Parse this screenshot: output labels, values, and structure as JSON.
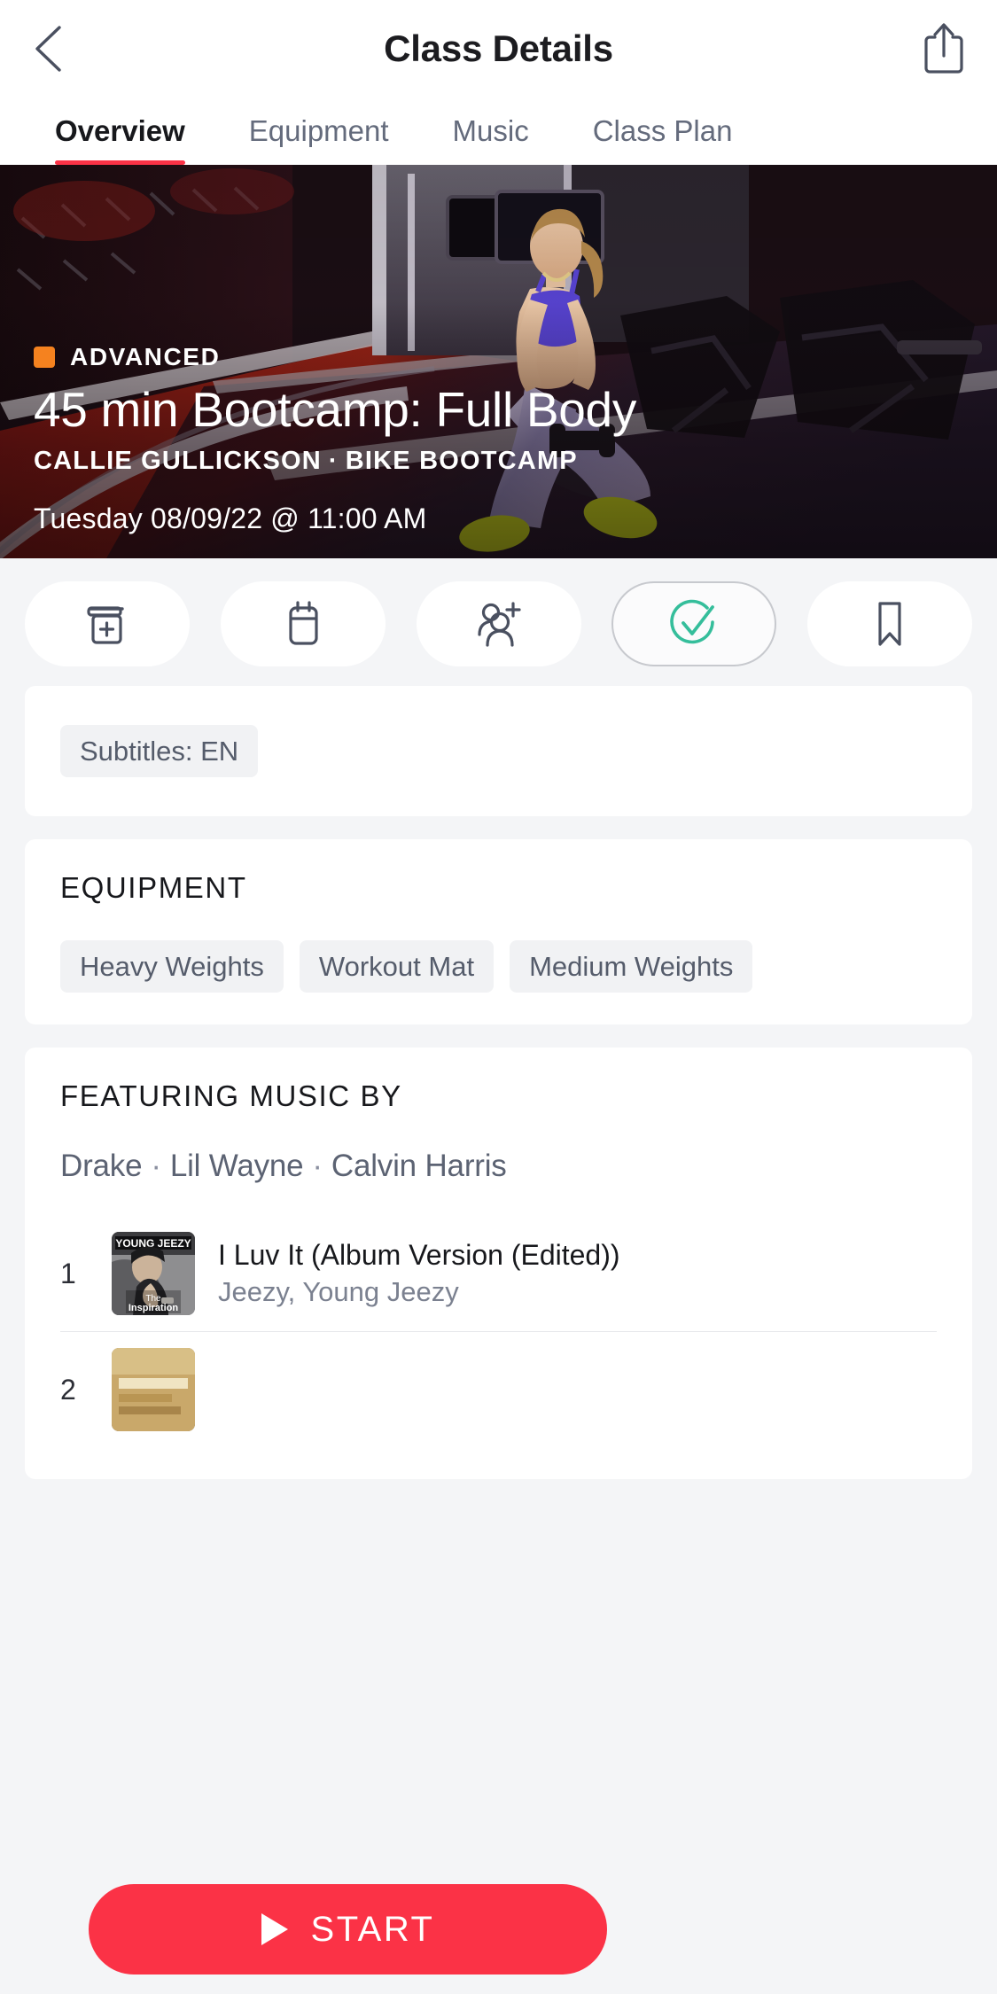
{
  "header": {
    "title": "Class Details",
    "back_icon": "chevron-left-icon",
    "share_icon": "share-icon"
  },
  "tabs": [
    {
      "label": "Overview",
      "active": true
    },
    {
      "label": "Equipment",
      "active": false
    },
    {
      "label": "Music",
      "active": false
    },
    {
      "label": "Class Plan",
      "active": false
    }
  ],
  "hero": {
    "difficulty": "ADVANCED",
    "difficulty_color": "#F5821F",
    "title": "45 min Bootcamp: Full Body",
    "instructor": "CALLIE GULLICKSON",
    "separator": "·",
    "discipline": "BIKE BOOTCAMP",
    "datetime": "Tuesday 08/09/22 @ 11:00 AM"
  },
  "actions": [
    {
      "name": "add-to-stack-button",
      "icon": "stack-add-icon",
      "active": false
    },
    {
      "name": "schedule-button",
      "icon": "calendar-icon",
      "active": false
    },
    {
      "name": "invite-friends-button",
      "icon": "add-friend-icon",
      "active": false
    },
    {
      "name": "mark-complete-button",
      "icon": "check-circle-icon",
      "active": true
    },
    {
      "name": "bookmark-button",
      "icon": "bookmark-icon",
      "active": false
    }
  ],
  "subtitles": {
    "chip": "Subtitles: EN"
  },
  "equipment": {
    "heading": "EQUIPMENT",
    "items": [
      "Heavy Weights",
      "Workout Mat",
      "Medium Weights"
    ]
  },
  "music": {
    "heading": "FEATURING MUSIC BY",
    "artists": [
      "Drake",
      "Lil Wayne",
      "Calvin Harris"
    ],
    "artist_separator": "·",
    "tracks": [
      {
        "number": "1",
        "title": "I Luv It (Album Version (Edited))",
        "artist": "Jeezy, Young Jeezy",
        "art_label": "YOUNG JEEZY",
        "art_sublabel": "The Inspiration"
      },
      {
        "number": "2",
        "title": "",
        "artist": "",
        "art_label": "",
        "art_sublabel": ""
      }
    ]
  },
  "start": {
    "label": "START",
    "icon": "play-icon",
    "color": "#FB3246"
  },
  "colors": {
    "accent_red": "#FB3246",
    "accent_green": "#35BE9B",
    "orange": "#F5821F",
    "page_bg": "#F4F5F7"
  }
}
